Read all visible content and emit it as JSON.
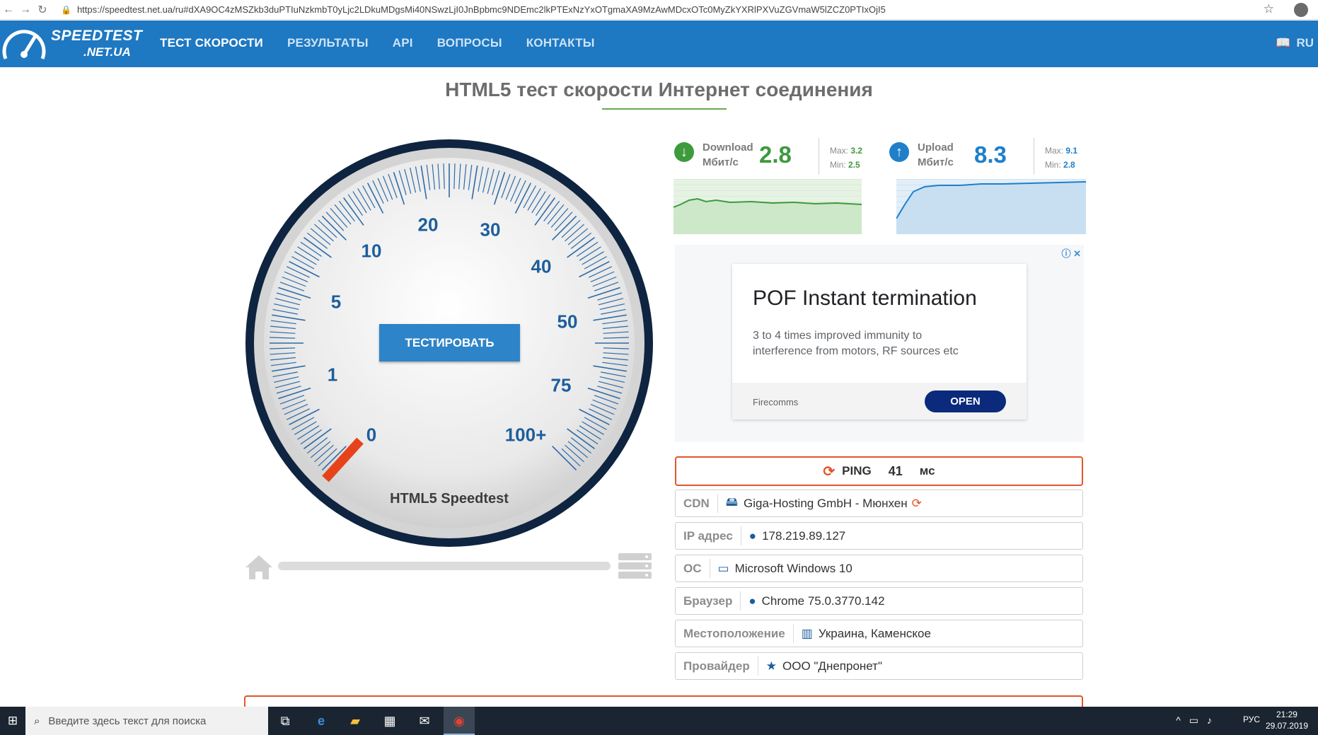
{
  "browser": {
    "url": "https://speedtest.net.ua/ru#dXA9OC4zMSZkb3duPTIuNzkmbT0yLjc2LDkuMDgsMi40NSwzLjI0JnBpbmc9NDEmc2lkPTExNzYxOTgmaXA9MzAwMDcxOTc0MyZkYXRlPXVuZGVmaW5lZCZ0PTIxOjI5"
  },
  "header": {
    "logo_top": "SPEEDTEST",
    "logo_bottom": ".NET.UA",
    "nav": [
      "ТЕСТ СКОРОСТИ",
      "РЕЗУЛЬТАТЫ",
      "API",
      "ВОПРОСЫ",
      "КОНТАКТЫ"
    ],
    "lang": "RU"
  },
  "page_title": "HTML5 тест скорости Интернет соединения",
  "gauge": {
    "scale": [
      "0",
      "1",
      "5",
      "10",
      "20",
      "30",
      "40",
      "50",
      "75",
      "100+"
    ],
    "button": "ТЕСТИРОВАТЬ",
    "label": "HTML5 Speedtest",
    "progress": 0
  },
  "download": {
    "label1": "Download",
    "label2": "Мбит/с",
    "value": "2.8",
    "max_label": "Max:",
    "max": "3.2",
    "min_label": "Min:",
    "min": "2.5",
    "color": "#3d9a3d"
  },
  "upload": {
    "label1": "Upload",
    "label2": "Мбит/с",
    "value": "8.3",
    "max_label": "Max:",
    "max": "9.1",
    "min_label": "Min:",
    "min": "2.8",
    "color": "#1f7fc9"
  },
  "ad": {
    "headline": "POF Instant termination",
    "body": "3 to 4 times improved immunity to interference from motors, RF sources etc",
    "brand": "Firecomms",
    "cta": "OPEN"
  },
  "ping": {
    "label": "PING",
    "value": "41",
    "unit": "мс"
  },
  "info": [
    {
      "key": "CDN",
      "value": "Giga-Hosting GmbH - Мюнхен",
      "icon": "server-icon"
    },
    {
      "key": "IP адрес",
      "value": "178.219.89.127",
      "icon": "globe-icon"
    },
    {
      "key": "ОС",
      "value": "Microsoft Windows 10",
      "icon": "monitor-icon"
    },
    {
      "key": "Браузер",
      "value": "Chrome 75.0.3770.142",
      "icon": "globe-icon"
    },
    {
      "key": "Местоположение",
      "value": "Украина, Каменское",
      "icon": "map-icon"
    },
    {
      "key": "Провайдер",
      "value": "ООО \"Днепронет\"",
      "icon": "star-icon"
    }
  ],
  "taskbar": {
    "search_placeholder": "Введите здесь текст для поиска",
    "lang": "РУС",
    "time": "21:29",
    "date": "29.07.2019"
  }
}
